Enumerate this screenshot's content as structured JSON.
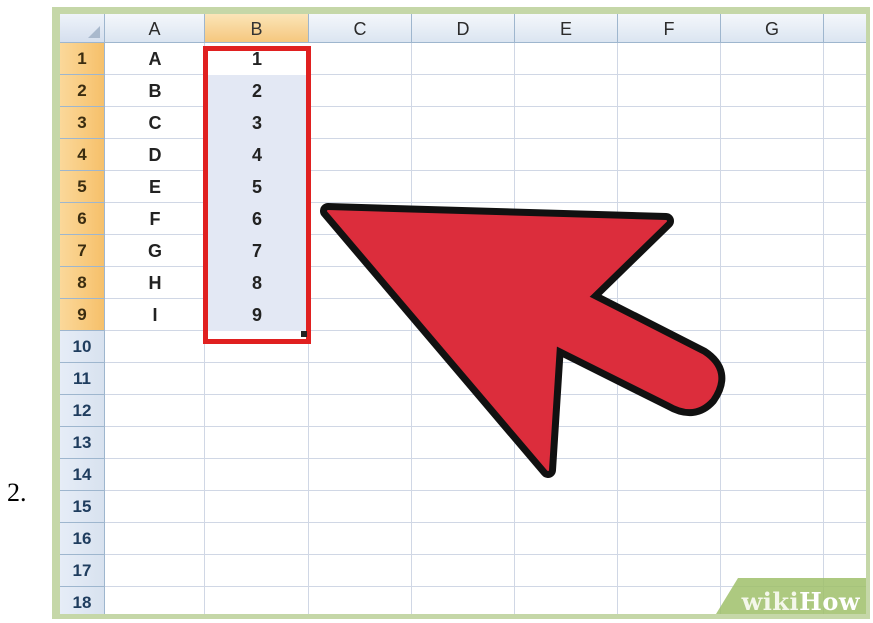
{
  "step_number": "2.",
  "columns": [
    "A",
    "B",
    "C",
    "D",
    "E",
    "F",
    "G"
  ],
  "selected_column": "B",
  "rows": [
    "1",
    "2",
    "3",
    "4",
    "5",
    "6",
    "7",
    "8",
    "9",
    "10",
    "11",
    "12",
    "13",
    "14",
    "15",
    "16",
    "17",
    "18"
  ],
  "selected_rows": [
    "1",
    "2",
    "3",
    "4",
    "5",
    "6",
    "7",
    "8",
    "9"
  ],
  "column_a": [
    "A",
    "B",
    "C",
    "D",
    "E",
    "F",
    "G",
    "H",
    "I"
  ],
  "column_b": [
    "1",
    "2",
    "3",
    "4",
    "5",
    "6",
    "7",
    "8",
    "9"
  ],
  "selection_range": "B1:B9",
  "annotation": {
    "arrow_color": "#dc2d3c",
    "highlight_color": "#e02020",
    "arrow_direction": "pointing up-left toward selection"
  },
  "watermark": {
    "prefix": "wiki",
    "suffix": "How"
  },
  "colors": {
    "frame": "#c5d7a8",
    "gridline": "#d0d7e5",
    "selected_header": "#f5c77e",
    "selected_cells": "#e3e8f4"
  }
}
